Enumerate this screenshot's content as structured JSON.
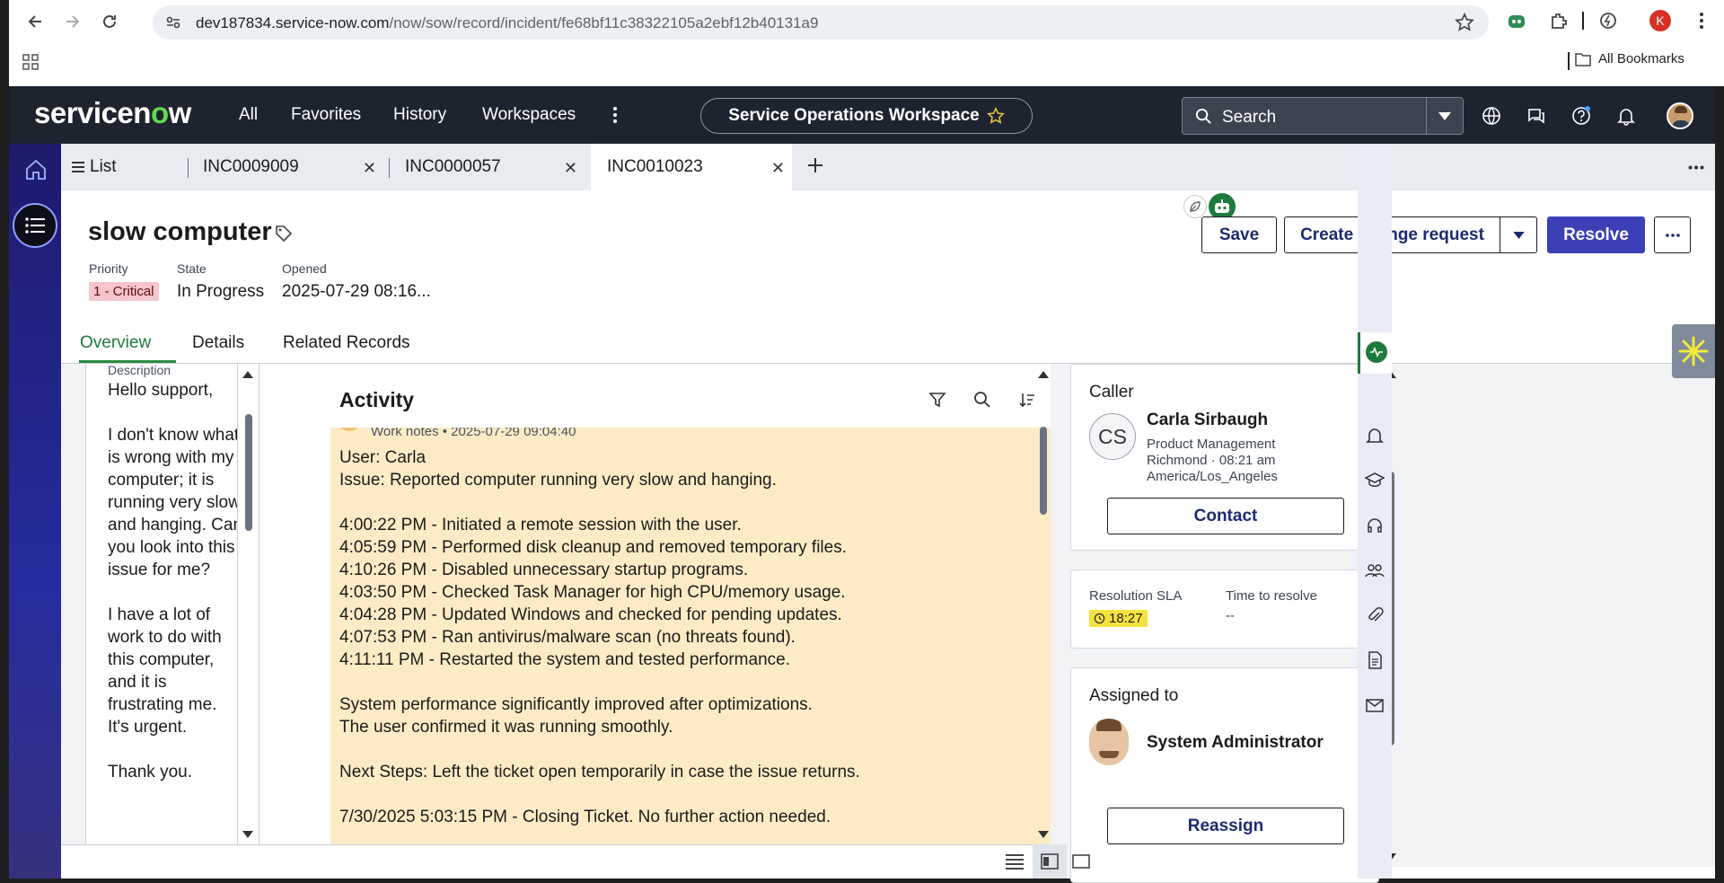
{
  "browser": {
    "url_host": "dev187834.service-now.com",
    "url_path": "/now/sow/record/incident/fe68bf11c38322105a2ebf12b40131a9",
    "bookmarks_label": "All Bookmarks",
    "profile_initial": "K"
  },
  "header": {
    "logo": "servicenow",
    "menu": [
      "All",
      "Favorites",
      "History",
      "Workspaces"
    ],
    "workspace": "Service Operations Workspace",
    "search_label": "Search"
  },
  "tabs": [
    {
      "label": "List"
    },
    {
      "label": "INC0009009"
    },
    {
      "label": "INC0000057"
    },
    {
      "label": "INC0010023"
    }
  ],
  "record": {
    "title": "slow computer",
    "priority_label": "Priority",
    "priority_value": "1 - Critical",
    "state_label": "State",
    "state_value": "In Progress",
    "opened_label": "Opened",
    "opened_value": "2025-07-29 08:16..."
  },
  "actions": {
    "save": "Save",
    "create_change": "Create change request",
    "resolve": "Resolve"
  },
  "record_tabs": [
    "Overview",
    "Details",
    "Related Records"
  ],
  "description": {
    "label": "Description",
    "text": "Hello support,\n\nI don't know what is wrong with my computer; it is running very slow and hanging. Can you look into this issue for me?\n\nI have a lot of work to do with this computer, and it is frustrating me. It's urgent.\n\nThank you."
  },
  "activity": {
    "title": "Activity",
    "entry_meta": "Work notes • 2025-07-29 09:04:40",
    "entry_text": "User: Carla\nIssue: Reported computer running very slow and hanging.\n\n4:00:22 PM - Initiated a remote session with the user.\n4:05:59 PM - Performed disk cleanup and removed temporary files.\n4:10:26 PM - Disabled unnecessary startup programs.\n4:03:50 PM - Checked Task Manager for high CPU/memory usage.\n4:04:28 PM - Updated Windows and checked for pending updates.\n4:07:53 PM - Ran antivirus/malware scan (no threats found).\n4:11:11 PM - Restarted the system and tested performance.\n\nSystem performance significantly improved after optimizations.\nThe user confirmed it was running smoothly.\n\nNext Steps: Left the ticket open temporarily in case the issue returns.\n\n7/30/2025 5:03:15 PM - Closing Ticket. No further action needed."
  },
  "caller": {
    "title": "Caller",
    "initials": "CS",
    "name": "Carla Sirbaugh",
    "department": "Product Management",
    "location": "Richmond · 08:21 am",
    "timezone": "America/Los_Angeles",
    "contact": "Contact"
  },
  "sla": {
    "label": "Resolution SLA",
    "value": "18:27",
    "ttr_label": "Time to resolve",
    "ttr_value": "--"
  },
  "assigned": {
    "title": "Assigned to",
    "name": "System Administrator",
    "reassign": "Reassign"
  },
  "colors": {
    "header_bg": "#1d2430",
    "accent_purple": "#3c3fb5",
    "worknote_bg": "#fdebc6",
    "critical_badge": "#f6c5cb",
    "sla_yellow": "#f5e33d",
    "logo_green": "#62d84e"
  }
}
